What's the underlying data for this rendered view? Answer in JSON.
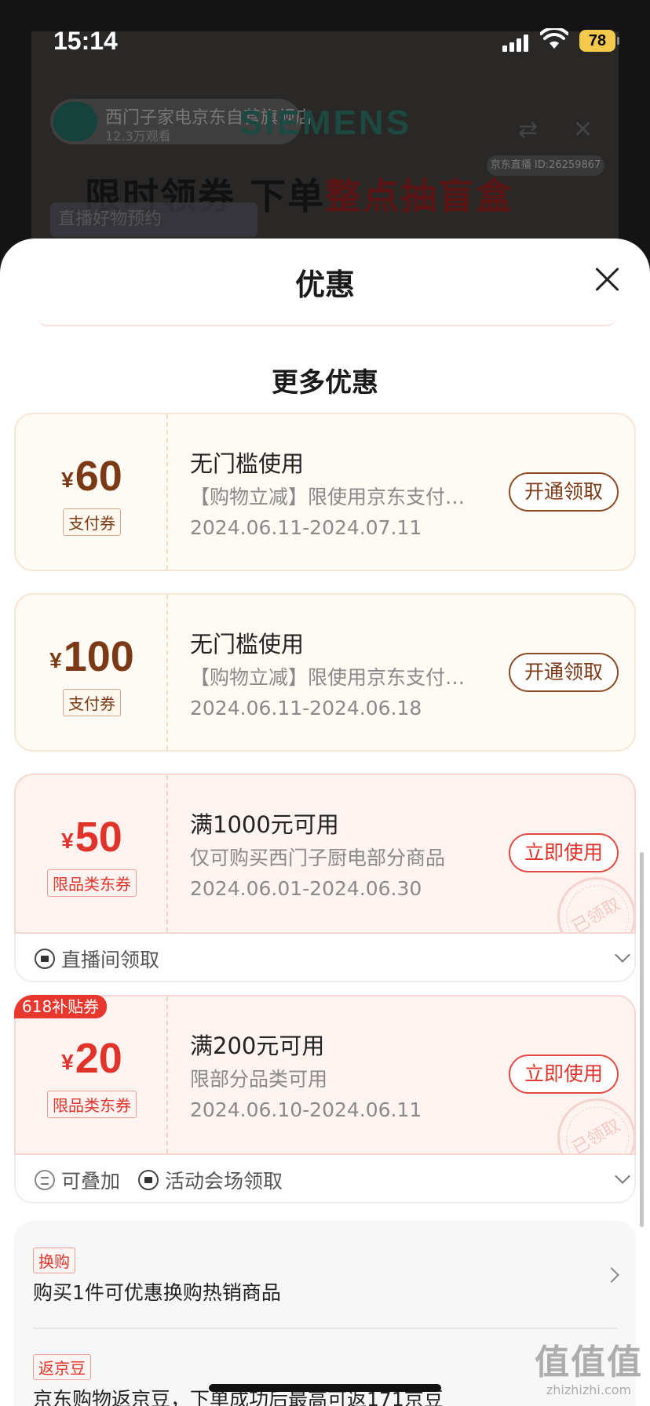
{
  "status_bar": {
    "time": "15:14",
    "battery": "78"
  },
  "background": {
    "shop_name": "西门子家电京东自营旗舰店",
    "shop_sub": "12.3万观看",
    "brand": "SIEMENS",
    "headline_black": "限时领券 下单",
    "headline_red": "整点抽盲盒",
    "tag": "京东直播 ID:26259867",
    "goods_label": "直播好物预约"
  },
  "sheet": {
    "title": "优惠",
    "section_title": "更多优惠"
  },
  "coupons": [
    {
      "symbol": "¥",
      "amount": "60",
      "type": "支付券",
      "title": "无门槛使用",
      "desc": "【购物立减】限使用京东支付…",
      "date": "2024.06.11-2024.07.11",
      "button": "开通领取"
    },
    {
      "symbol": "¥",
      "amount": "100",
      "type": "支付券",
      "title": "无门槛使用",
      "desc": "【购物立减】限使用京东支付…",
      "date": "2024.06.11-2024.06.18",
      "button": "开通领取"
    },
    {
      "symbol": "¥",
      "amount": "50",
      "type": "限品类东券",
      "title": "满1000元可用",
      "desc": "仅可购买西门子厨电部分商品",
      "date": "2024.06.01-2024.06.30",
      "button": "立即使用",
      "stamp": "已领取",
      "foot": [
        "直播间领取"
      ]
    },
    {
      "badge": "618补贴券",
      "symbol": "¥",
      "amount": "20",
      "type": "限品类东券",
      "title": "满200元可用",
      "desc": "限部分品类可用",
      "date": "2024.06.10-2024.06.11",
      "button": "立即使用",
      "stamp": "已领取",
      "foot": [
        "可叠加",
        "活动会场领取"
      ]
    }
  ],
  "promos": [
    {
      "tag": "换购",
      "text": "购买1件可优惠换购热销商品"
    },
    {
      "tag": "返京豆",
      "text": "京东购物返京豆，下单成功后最高可返171京豆"
    }
  ],
  "watermark": {
    "big": "值值值",
    "small": "zhizhizhi.com"
  }
}
